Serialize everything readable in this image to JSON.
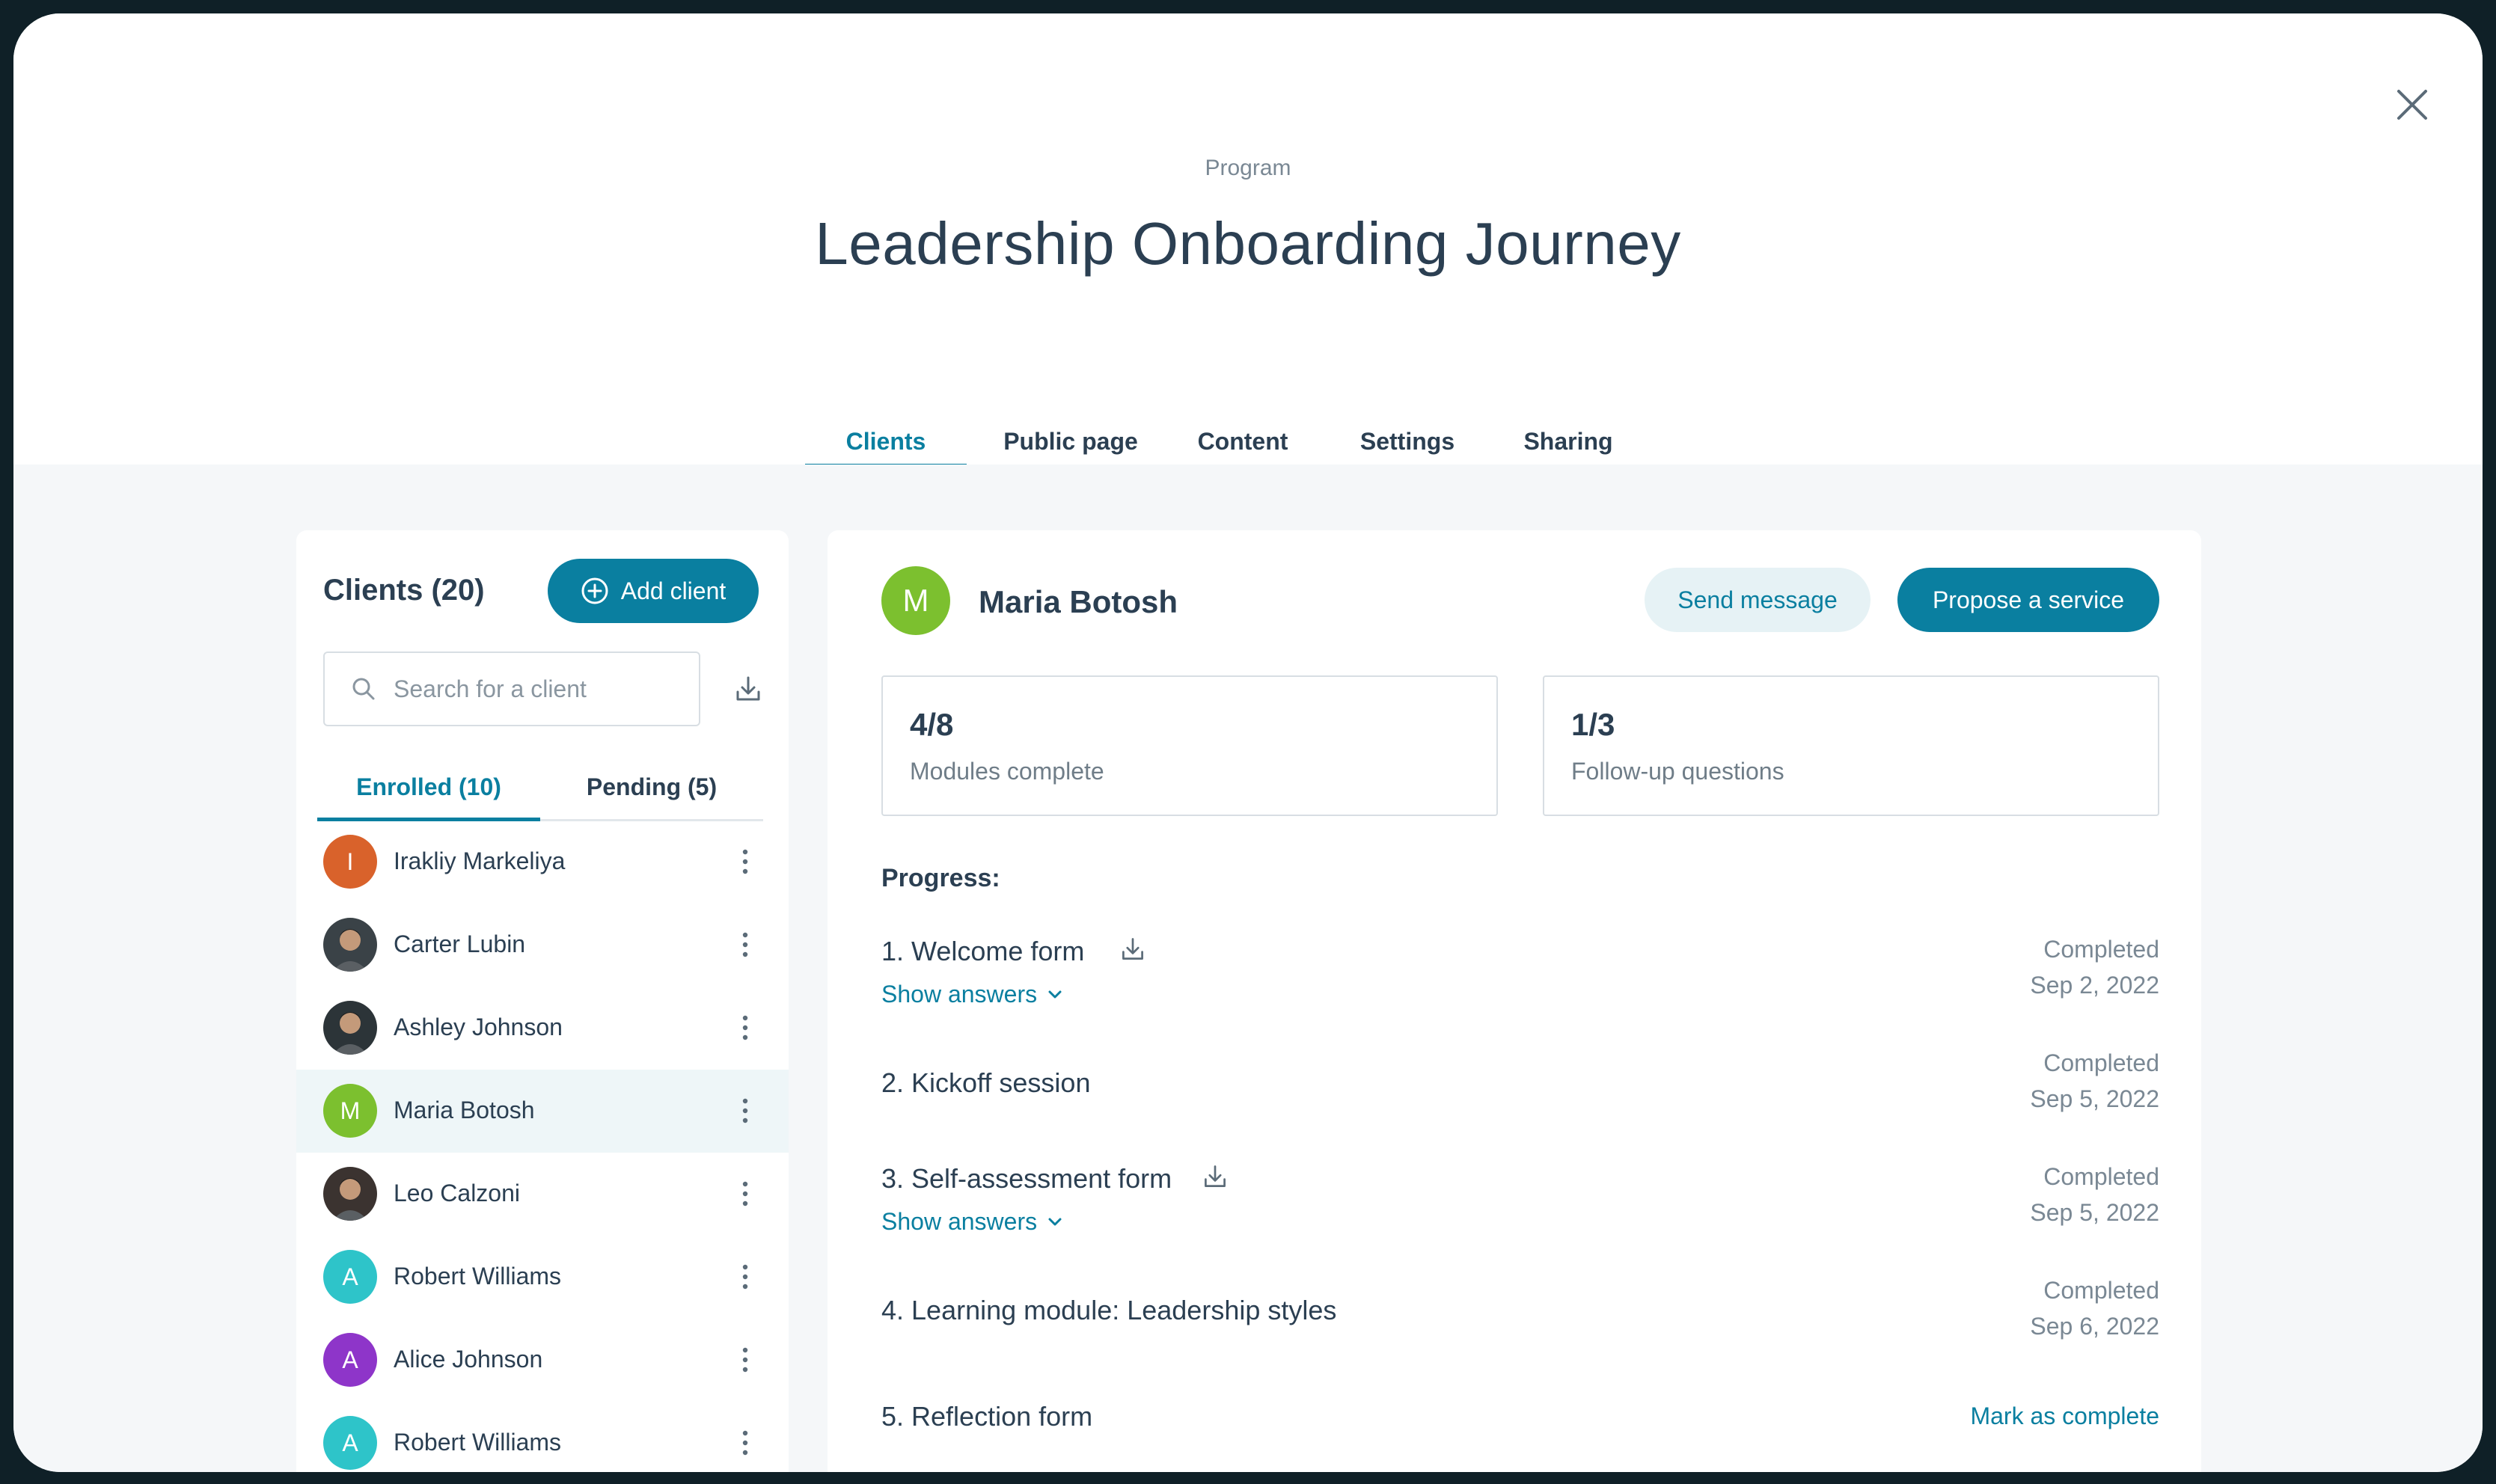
{
  "header": {
    "eyebrow": "Program",
    "title": "Leadership Onboarding Journey"
  },
  "tabs": [
    {
      "label": "Clients",
      "active": true
    },
    {
      "label": "Public page",
      "active": false
    },
    {
      "label": "Content",
      "active": false
    },
    {
      "label": "Settings",
      "active": false
    },
    {
      "label": "Sharing",
      "active": false
    }
  ],
  "clients_panel": {
    "title": "Clients (20)",
    "add_button": "Add client",
    "search_placeholder": "Search for a client",
    "subtabs": [
      {
        "label": "Enrolled (10)",
        "active": true
      },
      {
        "label": "Pending (5)",
        "active": false
      }
    ],
    "clients": [
      {
        "name": "Irakliy Markeliya",
        "initial": "I",
        "color": "#d9622b",
        "photo": false
      },
      {
        "name": "Carter Lubin",
        "initial": "",
        "color": "#3a4247",
        "photo": true
      },
      {
        "name": "Ashley Johnson",
        "initial": "",
        "color": "#2c3438",
        "photo": true
      },
      {
        "name": "Maria Botosh",
        "initial": "M",
        "color": "#7cc02f",
        "photo": false,
        "selected": true
      },
      {
        "name": "Leo Calzoni",
        "initial": "",
        "color": "#3b3330",
        "photo": true
      },
      {
        "name": "Robert Williams",
        "initial": "A",
        "color": "#2ec4c9",
        "photo": false
      },
      {
        "name": "Alice Johnson",
        "initial": "A",
        "color": "#8e35c9",
        "photo": false
      },
      {
        "name": "Robert Williams",
        "initial": "A",
        "color": "#2ec4c9",
        "photo": false
      }
    ]
  },
  "detail": {
    "initial": "M",
    "name": "Maria Botosh",
    "send_message": "Send message",
    "propose_service": "Propose a service",
    "stats": [
      {
        "value": "4/8",
        "label": "Modules complete"
      },
      {
        "value": "1/3",
        "label": "Follow-up questions"
      }
    ],
    "progress_title": "Progress:",
    "modules": [
      {
        "name": "1. Welcome form",
        "download": true,
        "show_answers": "Show answers",
        "status": "Completed",
        "date": "Sep 2, 2022"
      },
      {
        "name": "2. Kickoff session",
        "download": false,
        "show_answers": "",
        "status": "Completed",
        "date": "Sep 5, 2022"
      },
      {
        "name": "3. Self-assessment form",
        "download": true,
        "show_answers": "Show answers",
        "status": "Completed",
        "date": "Sep 5, 2022"
      },
      {
        "name": "4. Learning module: Leadership styles",
        "download": false,
        "show_answers": "",
        "status": "Completed",
        "date": "Sep 6, 2022"
      },
      {
        "name": "5. Reflection form",
        "download": false,
        "show_answers": "",
        "action": "Mark as complete"
      }
    ]
  },
  "colors": {
    "accent": "#0a7fa0",
    "accent_light": "#e6f2f5",
    "selected_row": "#eef6f8"
  },
  "icons": [
    "close-icon",
    "plus-circle-icon",
    "search-icon",
    "download-icon",
    "kebab-icon",
    "chevron-down-icon"
  ]
}
